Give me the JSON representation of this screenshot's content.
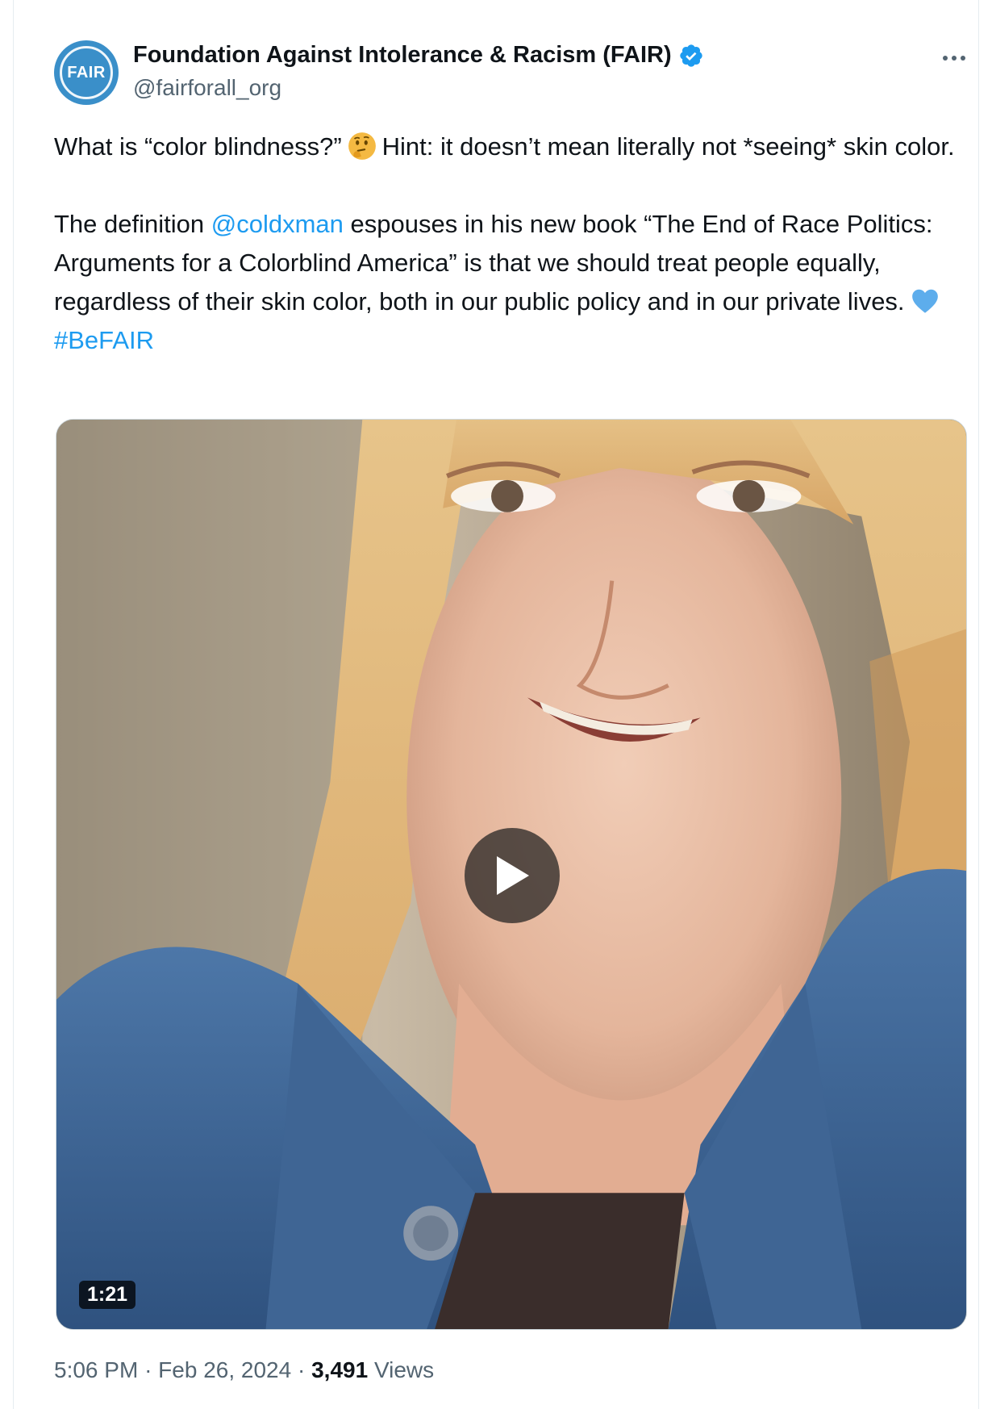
{
  "author": {
    "display_name": "Foundation Against Intolerance & Racism (FAIR)",
    "handle": "@fairforall_org",
    "avatar_text": "FAIR",
    "verified": true
  },
  "tweet": {
    "line1_before": "What is “color blindness?”",
    "emoji1": "thinking-face",
    "line1_after": "Hint: it doesn’t mean literally not *seeing* skin color.",
    "p2_before": "The definition ",
    "mention": "@coldxman",
    "p2_after": " espouses in his new book “The End of Race Politics: Arguments for a Colorblind America” is that we should treat people equally, regardless of their skin color, both in our public policy and in our private lives.",
    "emoji2": "blue-heart",
    "hashtag": "#BeFAIR"
  },
  "media": {
    "duration": "1:21"
  },
  "meta": {
    "time": "5:06 PM",
    "separator": "·",
    "date": "Feb 26, 2024",
    "views_count": "3,491",
    "views_label": "Views"
  },
  "colors": {
    "link": "#1d9bf0",
    "verified": "#1d9bf0",
    "avatar_bg": "#3a8fc9",
    "secondary_text": "#536471"
  }
}
